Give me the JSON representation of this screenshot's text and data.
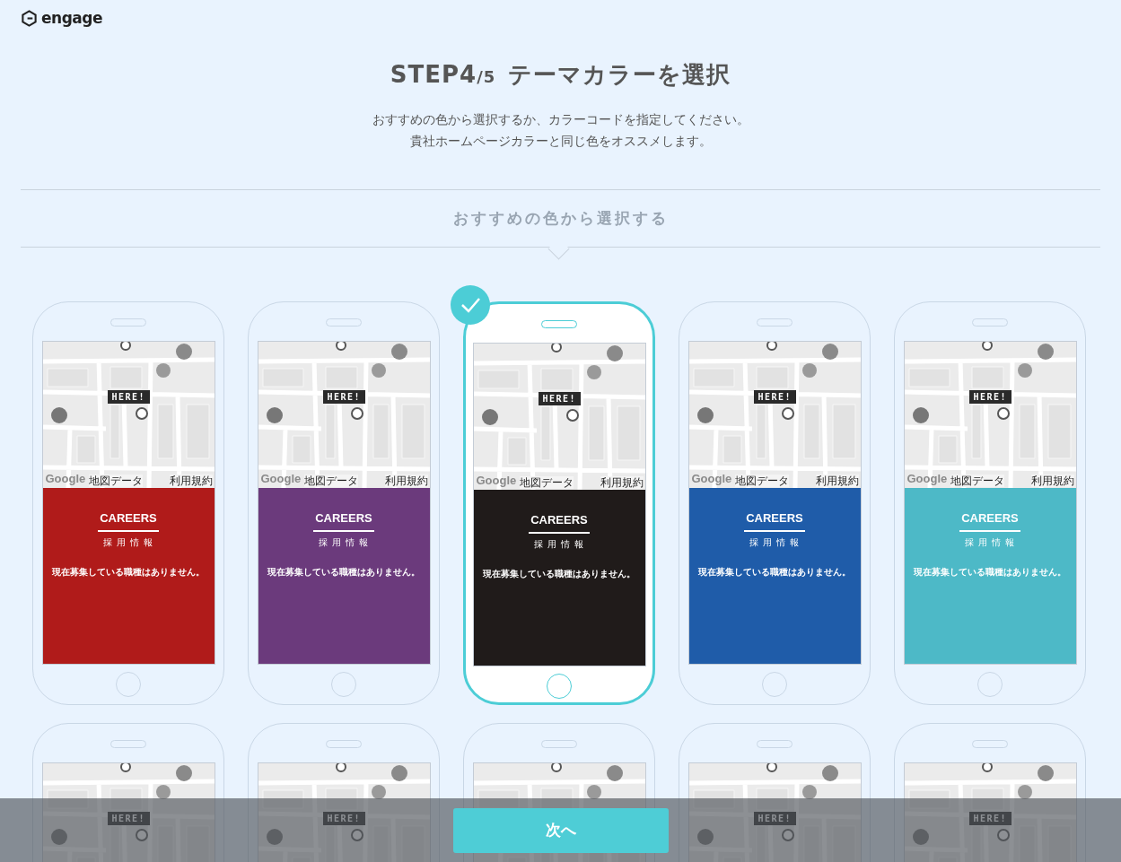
{
  "logo": {
    "text": "engage"
  },
  "heading": {
    "step": "STEP4",
    "step_total": "/5",
    "title": "テーマカラーを選択"
  },
  "description": [
    "おすすめの色から選択するか、カラーコードを指定してください。",
    "貴社ホームページカラーと同じ色をオススメします。"
  ],
  "section_title": "おすすめの色から選択する",
  "themes": [
    {
      "selected": false,
      "color": "#b01b1a",
      "here": "HERE!",
      "map_logo": "Google",
      "map_credit": "地図データ",
      "map_terms": "利用規約",
      "title": "CAREERS",
      "subtitle": "採 用 情 報",
      "message": "現在募集している職種はありません。"
    },
    {
      "selected": false,
      "color": "#6b3a7c",
      "here": "HERE!",
      "map_logo": "Google",
      "map_credit": "地図データ",
      "map_terms": "利用規約",
      "title": "CAREERS",
      "subtitle": "採 用 情 報",
      "message": "現在募集している職種はありません。"
    },
    {
      "selected": true,
      "color": "#201b1a",
      "here": "HERE!",
      "map_logo": "Google",
      "map_credit": "地図データ",
      "map_terms": "利用規約",
      "title": "CAREERS",
      "subtitle": "採 用 情 報",
      "message": "現在募集している職種はありません。"
    },
    {
      "selected": false,
      "color": "#1f5ca9",
      "here": "HERE!",
      "map_logo": "Google",
      "map_credit": "地図データ",
      "map_terms": "利用規約",
      "title": "CAREERS",
      "subtitle": "採 用 情 報",
      "message": "現在募集している職種はありません。"
    },
    {
      "selected": false,
      "color": "#4db9c7",
      "here": "HERE!",
      "map_logo": "Google",
      "map_credit": "地図データ",
      "map_terms": "利用規約",
      "title": "CAREERS",
      "subtitle": "採 用 情 報",
      "message": "現在募集している職種はありません。"
    },
    {
      "selected": false,
      "here": "HERE!"
    },
    {
      "selected": false,
      "here": "HERE!"
    },
    {
      "selected": false
    },
    {
      "selected": false,
      "here": "HERE!"
    },
    {
      "selected": false,
      "here": "HERE!"
    }
  ],
  "next_button": "次へ"
}
